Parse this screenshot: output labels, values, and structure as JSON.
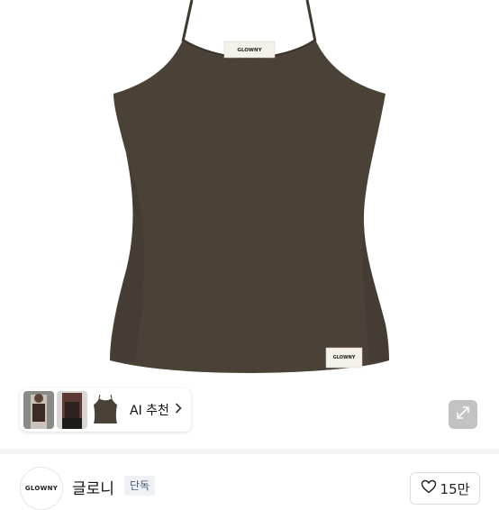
{
  "product": {
    "garment_label": "GLOWNY",
    "hem_label": "GLOWNY",
    "garment_color": "#4a4237"
  },
  "gallery": {
    "ai_recommend_label": "AI 추천",
    "chevron_icon": "chevron-right-icon",
    "expand_icon": "expand-icon"
  },
  "shop": {
    "logo_text": "GLOWNY",
    "name": "글로니",
    "badge": "단독",
    "like_icon": "heart-outline-icon",
    "like_count": "15만"
  }
}
